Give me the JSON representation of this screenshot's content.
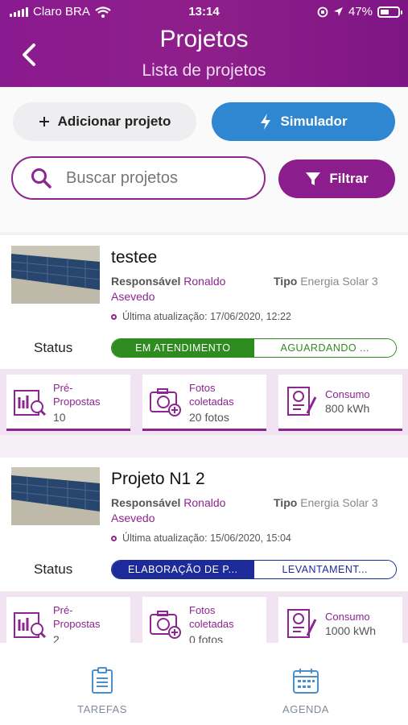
{
  "statusbar": {
    "carrier": "Claro BRA",
    "time": "13:14",
    "battery": "47%"
  },
  "header": {
    "title": "Projetos",
    "subtitle": "Lista de projetos"
  },
  "actions": {
    "add_label": "Adicionar projeto",
    "sim_label": "Simulador",
    "filter_label": "Filtrar"
  },
  "search": {
    "placeholder": "Buscar projetos"
  },
  "labels": {
    "responsavel": "Responsável",
    "tipo": "Tipo",
    "status": "Status"
  },
  "projects": [
    {
      "name": "testee",
      "responsavel_line1": "Ronaldo",
      "responsavel_line2": "Asevedo",
      "tipo": "Energia Solar 3",
      "updated": "Última atualização: 17/06/2020, 12:22",
      "status_active": "EM ATENDIMENTO",
      "status_next": "AGUARDANDO ...",
      "status_color": "#2e8b1f",
      "stats": [
        {
          "name1": "Pré-",
          "name2": "Propostas",
          "value": "10"
        },
        {
          "name1": "Fotos",
          "name2": "coletadas",
          "value": "20 fotos"
        },
        {
          "name1": "Consumo",
          "value": "800 kWh"
        }
      ]
    },
    {
      "name": "Projeto N1 2",
      "responsavel_line1": "Ronaldo",
      "responsavel_line2": "Asevedo",
      "tipo": "Energia Solar 3",
      "updated": "Última atualização: 15/06/2020, 15:04",
      "status_active": "ELABORAÇÃO DE P...",
      "status_next": "LEVANTAMENT...",
      "status_color": "#1d2b9a",
      "stats": [
        {
          "name1": "Pré-",
          "name2": "Propostas",
          "value": "2"
        },
        {
          "name1": "Fotos",
          "name2": "coletadas",
          "value": "0 fotos"
        },
        {
          "name1": "Consumo",
          "value": "1000 kWh"
        }
      ]
    }
  ],
  "tabbar": {
    "tab1": "TAREFAS",
    "tab2": "AGENDA"
  },
  "colors": {
    "brand": "#8c2590",
    "accent_blue": "#2f86d1",
    "header": "#8a1a8f"
  }
}
